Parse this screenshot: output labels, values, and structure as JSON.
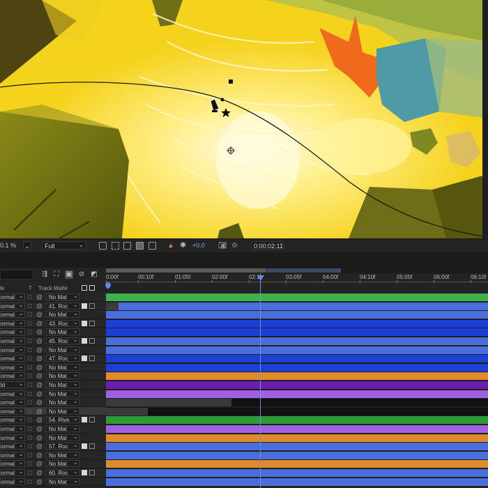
{
  "viewer": {
    "magnification_suffix": "0.1 %",
    "resolution": "Full",
    "exposure": "+0.0",
    "current_time": "0:00:02:11"
  },
  "timeline": {
    "columns": {
      "mode_partial": "le",
      "t": "T",
      "track_matte": "Track Matte"
    },
    "ticks": [
      "0:00f",
      "00:10f",
      "01:05f",
      "02:00f",
      "02:1",
      "03:05f",
      "04:00f",
      "04:10f",
      "05:05f",
      "06:00f",
      "06:10f"
    ],
    "layers": [
      {
        "mode": "ormal",
        "matte": "No Mat",
        "color": "#3fb24a",
        "t1": false
      },
      {
        "mode": "ormal",
        "matte": "41. Roc",
        "color": "#4a6fdc",
        "t1": true,
        "gray_start": true
      },
      {
        "mode": "ormal",
        "matte": "No Mat",
        "color": "#4a6fdc",
        "t1": false
      },
      {
        "mode": "ormal",
        "matte": "43. Roc",
        "color": "#1d3fd6",
        "t1": true
      },
      {
        "mode": "ormal",
        "matte": "No Mat",
        "color": "#1d3fd6",
        "t1": false
      },
      {
        "mode": "ormal",
        "matte": "45. Roc",
        "color": "#4a6fdc",
        "t1": true
      },
      {
        "mode": "ormal",
        "matte": "No Mat",
        "color": "#4a6fdc",
        "t1": false
      },
      {
        "mode": "ormal",
        "matte": "47. Roc",
        "color": "#1d3fd6",
        "t1": true
      },
      {
        "mode": "ormal",
        "matte": "No Mat",
        "color": "#1d3fd6",
        "t1": false
      },
      {
        "mode": "ormal",
        "matte": "No Mat",
        "color": "#e08a2e",
        "t1": false
      },
      {
        "mode": "ld",
        "matte": "No Mat",
        "color": "#6a1fb0",
        "t1": false
      },
      {
        "mode": "ormal",
        "matte": "No Mat",
        "color": "#a060e0",
        "t1": false
      },
      {
        "mode": "ormal",
        "matte": "No Mat",
        "color": "#111111",
        "t1": false,
        "gray_span": [
          0,
          180
        ]
      },
      {
        "mode": "ormal",
        "matte": "No Mat",
        "color": "#111111",
        "t1": false,
        "gray_span": [
          0,
          60
        ],
        "dark_row": true
      },
      {
        "mode": "ormal",
        "matte": "54. Rive",
        "color": "#2e9a3a",
        "t1": true
      },
      {
        "mode": "ormal",
        "matte": "No Mat",
        "color": "#a060e0",
        "t1": false
      },
      {
        "mode": "ormal",
        "matte": "No Mat",
        "color": "#e08a2e",
        "t1": false
      },
      {
        "mode": "ormal",
        "matte": "57. Roc",
        "color": "#4a6fdc",
        "t1": true
      },
      {
        "mode": "ormal",
        "matte": "No Mat",
        "color": "#4a6fdc",
        "t1": false
      },
      {
        "mode": "ormal",
        "matte": "No Mat",
        "color": "#e08a2e",
        "t1": false
      },
      {
        "mode": "ormal",
        "matte": "60. Roc",
        "color": "#4a6fdc",
        "t1": true
      },
      {
        "mode": "ormal",
        "matte": "No Mat",
        "color": "#4a6fdc",
        "t1": false
      }
    ]
  }
}
